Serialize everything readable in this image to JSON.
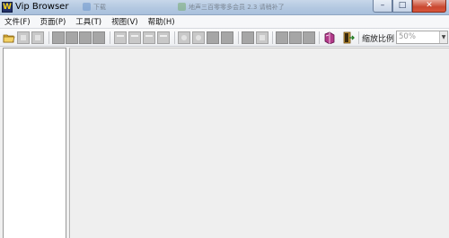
{
  "window": {
    "title": "Vip Browser",
    "app_icon_letter": "W",
    "background_tasks": [
      {
        "label": "下载"
      },
      {
        "label": "地声三百零零多会员 2.3 请稍补了"
      }
    ],
    "controls": {
      "minimize": "–",
      "maximize": "□",
      "close": "✕"
    }
  },
  "menu": {
    "items": [
      {
        "label": "文件(F)"
      },
      {
        "label": "页面(P)"
      },
      {
        "label": "工具(T)"
      },
      {
        "label": "视图(V)"
      },
      {
        "label": "帮助(H)"
      }
    ]
  },
  "toolbar": {
    "zoom_label": "缩放比例",
    "zoom_value": "50%",
    "dropdown_icon": "▼",
    "buttons": [
      {
        "icon": "open-folder-icon",
        "enabled": true
      },
      {
        "icon": "save-icon",
        "enabled": false
      },
      {
        "icon": "print-icon",
        "enabled": false
      },
      {
        "icon": "first-page-icon",
        "enabled": false
      },
      {
        "icon": "prev-page-icon",
        "enabled": false
      },
      {
        "icon": "next-page-icon",
        "enabled": false
      },
      {
        "icon": "last-page-icon",
        "enabled": false
      },
      {
        "icon": "rotate-left-icon",
        "enabled": false
      },
      {
        "icon": "rotate-right-icon",
        "enabled": false
      },
      {
        "icon": "flip-icon",
        "enabled": false
      },
      {
        "icon": "mirror-icon",
        "enabled": false
      },
      {
        "icon": "zoom-in-icon",
        "enabled": false
      },
      {
        "icon": "zoom-out-icon",
        "enabled": false
      },
      {
        "icon": "fit-width-icon",
        "enabled": false
      },
      {
        "icon": "fit-page-icon",
        "enabled": false
      },
      {
        "icon": "single-page-icon",
        "enabled": false
      },
      {
        "icon": "two-page-icon",
        "enabled": false
      },
      {
        "icon": "thumbnail-icon",
        "enabled": false
      },
      {
        "icon": "bookmark-icon",
        "enabled": false
      },
      {
        "icon": "fullscreen-icon",
        "enabled": false
      },
      {
        "icon": "book-icon",
        "enabled": true
      },
      {
        "icon": "exit-icon",
        "enabled": true
      }
    ]
  }
}
